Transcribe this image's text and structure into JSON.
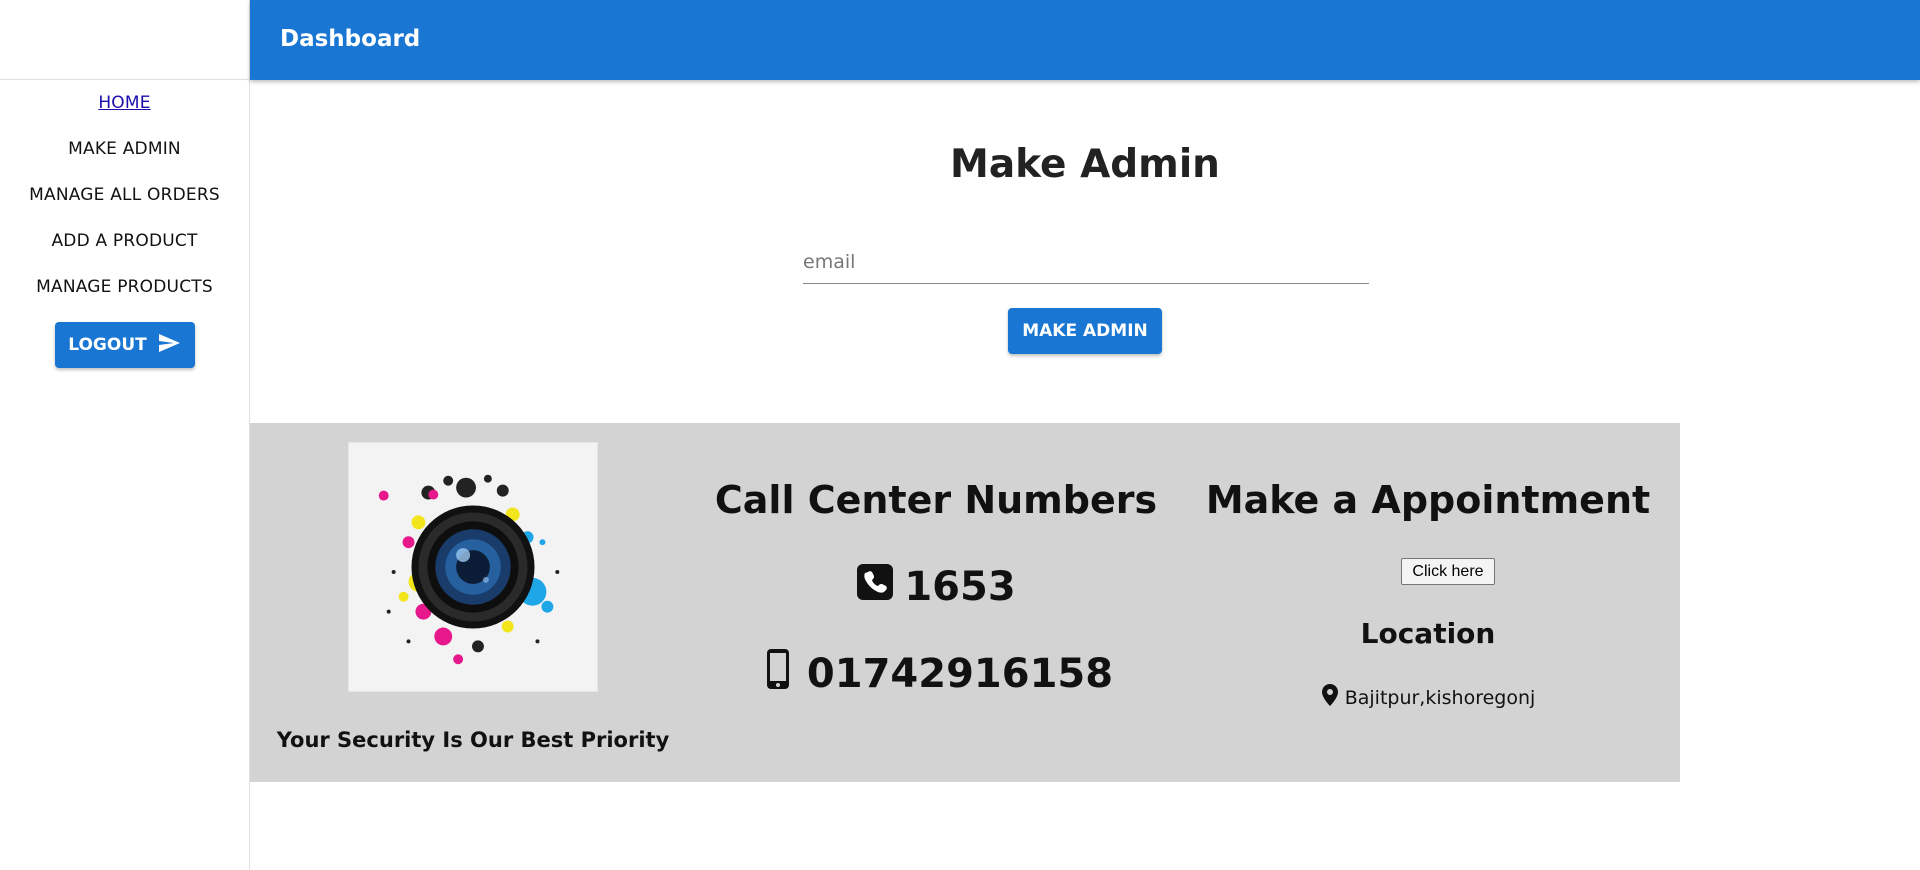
{
  "header": {
    "title": "Dashboard"
  },
  "sidebar": {
    "items": [
      {
        "label": "HOME",
        "active": true
      },
      {
        "label": "MAKE ADMIN"
      },
      {
        "label": "MANAGE ALL ORDERS"
      },
      {
        "label": "ADD A PRODUCT"
      },
      {
        "label": "MANAGE PRODUCTS"
      }
    ],
    "logout_label": "LOGOUT",
    "logout_icon": "send-icon"
  },
  "main": {
    "title": "Make Admin",
    "email_placeholder": "email",
    "email_value": "",
    "submit_label": "MAKE ADMIN"
  },
  "footer": {
    "logo_icon": "camera-lens-splash-logo",
    "tagline": "Your Security Is Our Best Priority",
    "call_center": {
      "heading": "Call Center Numbers",
      "phone1": "1653",
      "phone1_icon": "phone-square-icon",
      "phone2": "01742916158",
      "phone2_icon": "mobile-phone-icon"
    },
    "appointment": {
      "heading": "Make a Appointment",
      "button_label": "Click here",
      "location_heading": "Location",
      "location_icon": "map-marker-icon",
      "location": "Bajitpur,kishoregonj"
    }
  },
  "colors": {
    "primary": "#1976d2",
    "footer_bg": "#d3d3d3",
    "link": "#1a0dab"
  }
}
